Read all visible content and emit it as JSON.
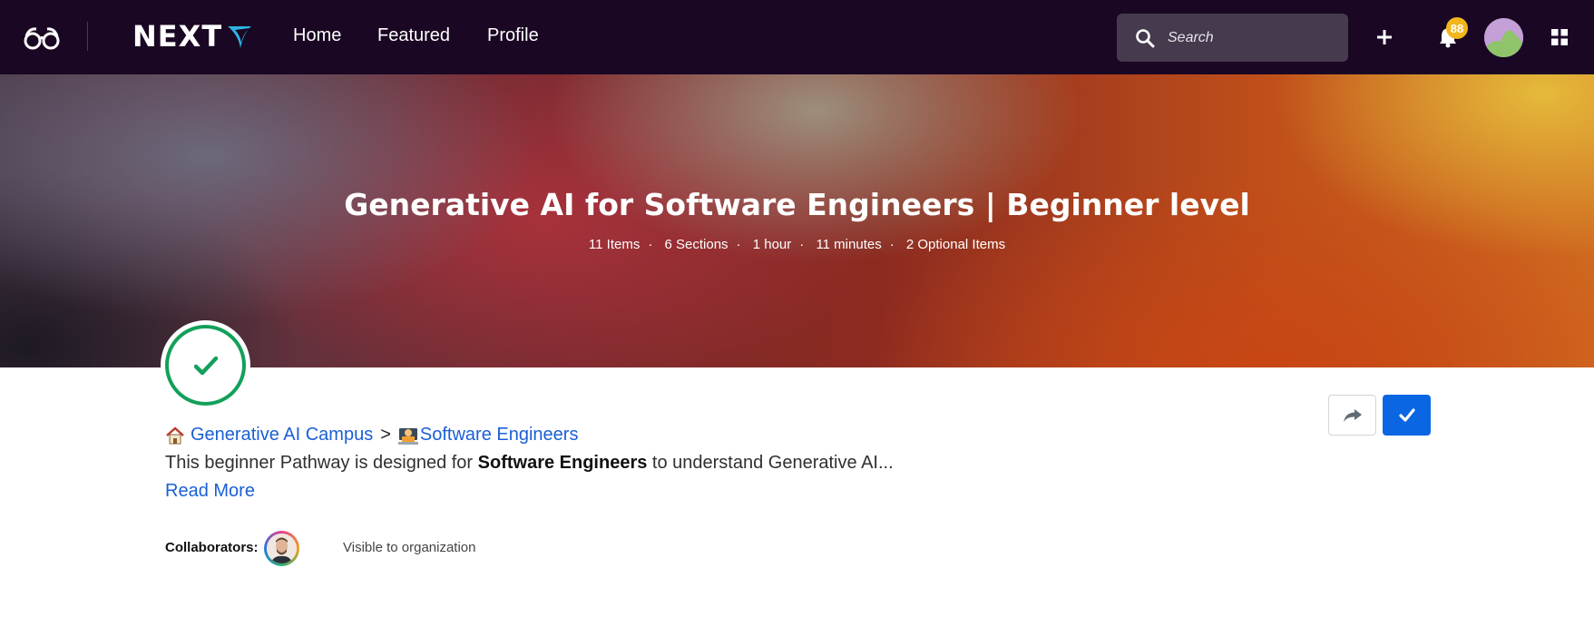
{
  "nav": {
    "brand": "NEXT",
    "links": [
      "Home",
      "Featured",
      "Profile"
    ],
    "search_placeholder": "Search",
    "notification_count": "88",
    "icons": [
      "glasses-logo-icon",
      "search-icon",
      "plus-icon",
      "bell-icon",
      "apps-grid-icon"
    ]
  },
  "hero": {
    "title": "Generative AI for Software Engineers | Beginner level",
    "meta": [
      "11 Items",
      "6 Sections",
      "1 hour",
      "11 minutes",
      "2 Optional Items"
    ]
  },
  "content": {
    "breadcrumb": {
      "parent": "Generative AI Campus",
      "separator": ">",
      "child": "Software Engineers"
    },
    "description_prefix": "This beginner Pathway is designed for ",
    "description_bold": "Software Engineers",
    "description_suffix": " to understand Generative AI...",
    "read_more": "Read More",
    "collaborators_label": "Collaborators:",
    "visibility": "Visible to organization"
  },
  "colors": {
    "nav_bg": "#1a0723",
    "accent_blue": "#0b66e4",
    "link_blue": "#1a5fd6",
    "complete_green": "#13a05a",
    "badge_yellow": "#f2b61a"
  }
}
